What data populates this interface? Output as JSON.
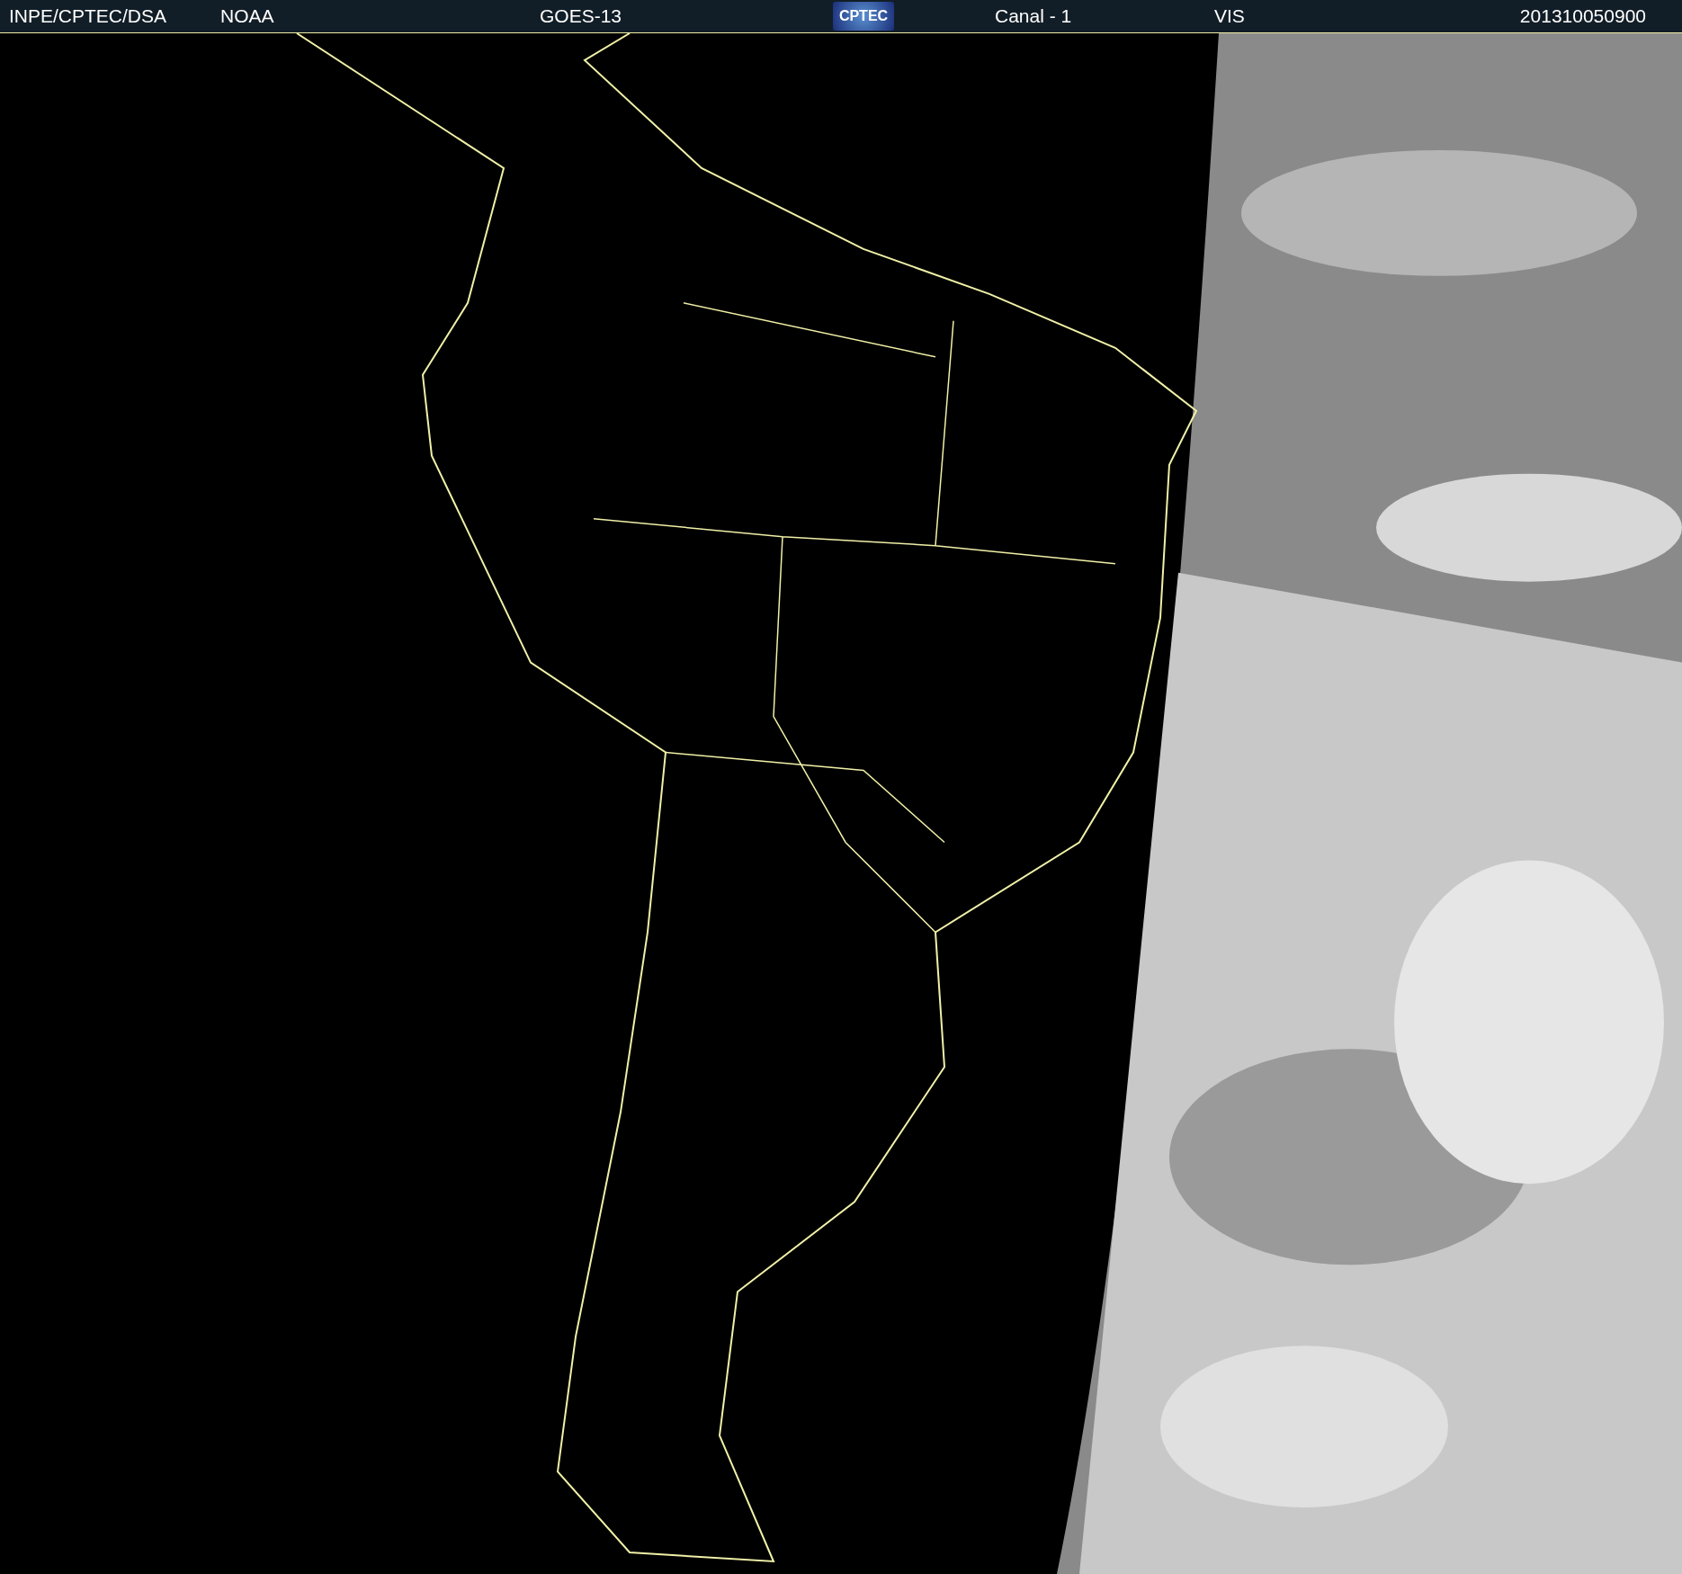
{
  "header": {
    "source": "INPE/CPTEC/DSA",
    "agency": "NOAA",
    "satellite": "GOES-13",
    "logo": "CPTEC",
    "channel": "Canal - 1",
    "band": "VIS",
    "timestamp": "201310050900"
  }
}
